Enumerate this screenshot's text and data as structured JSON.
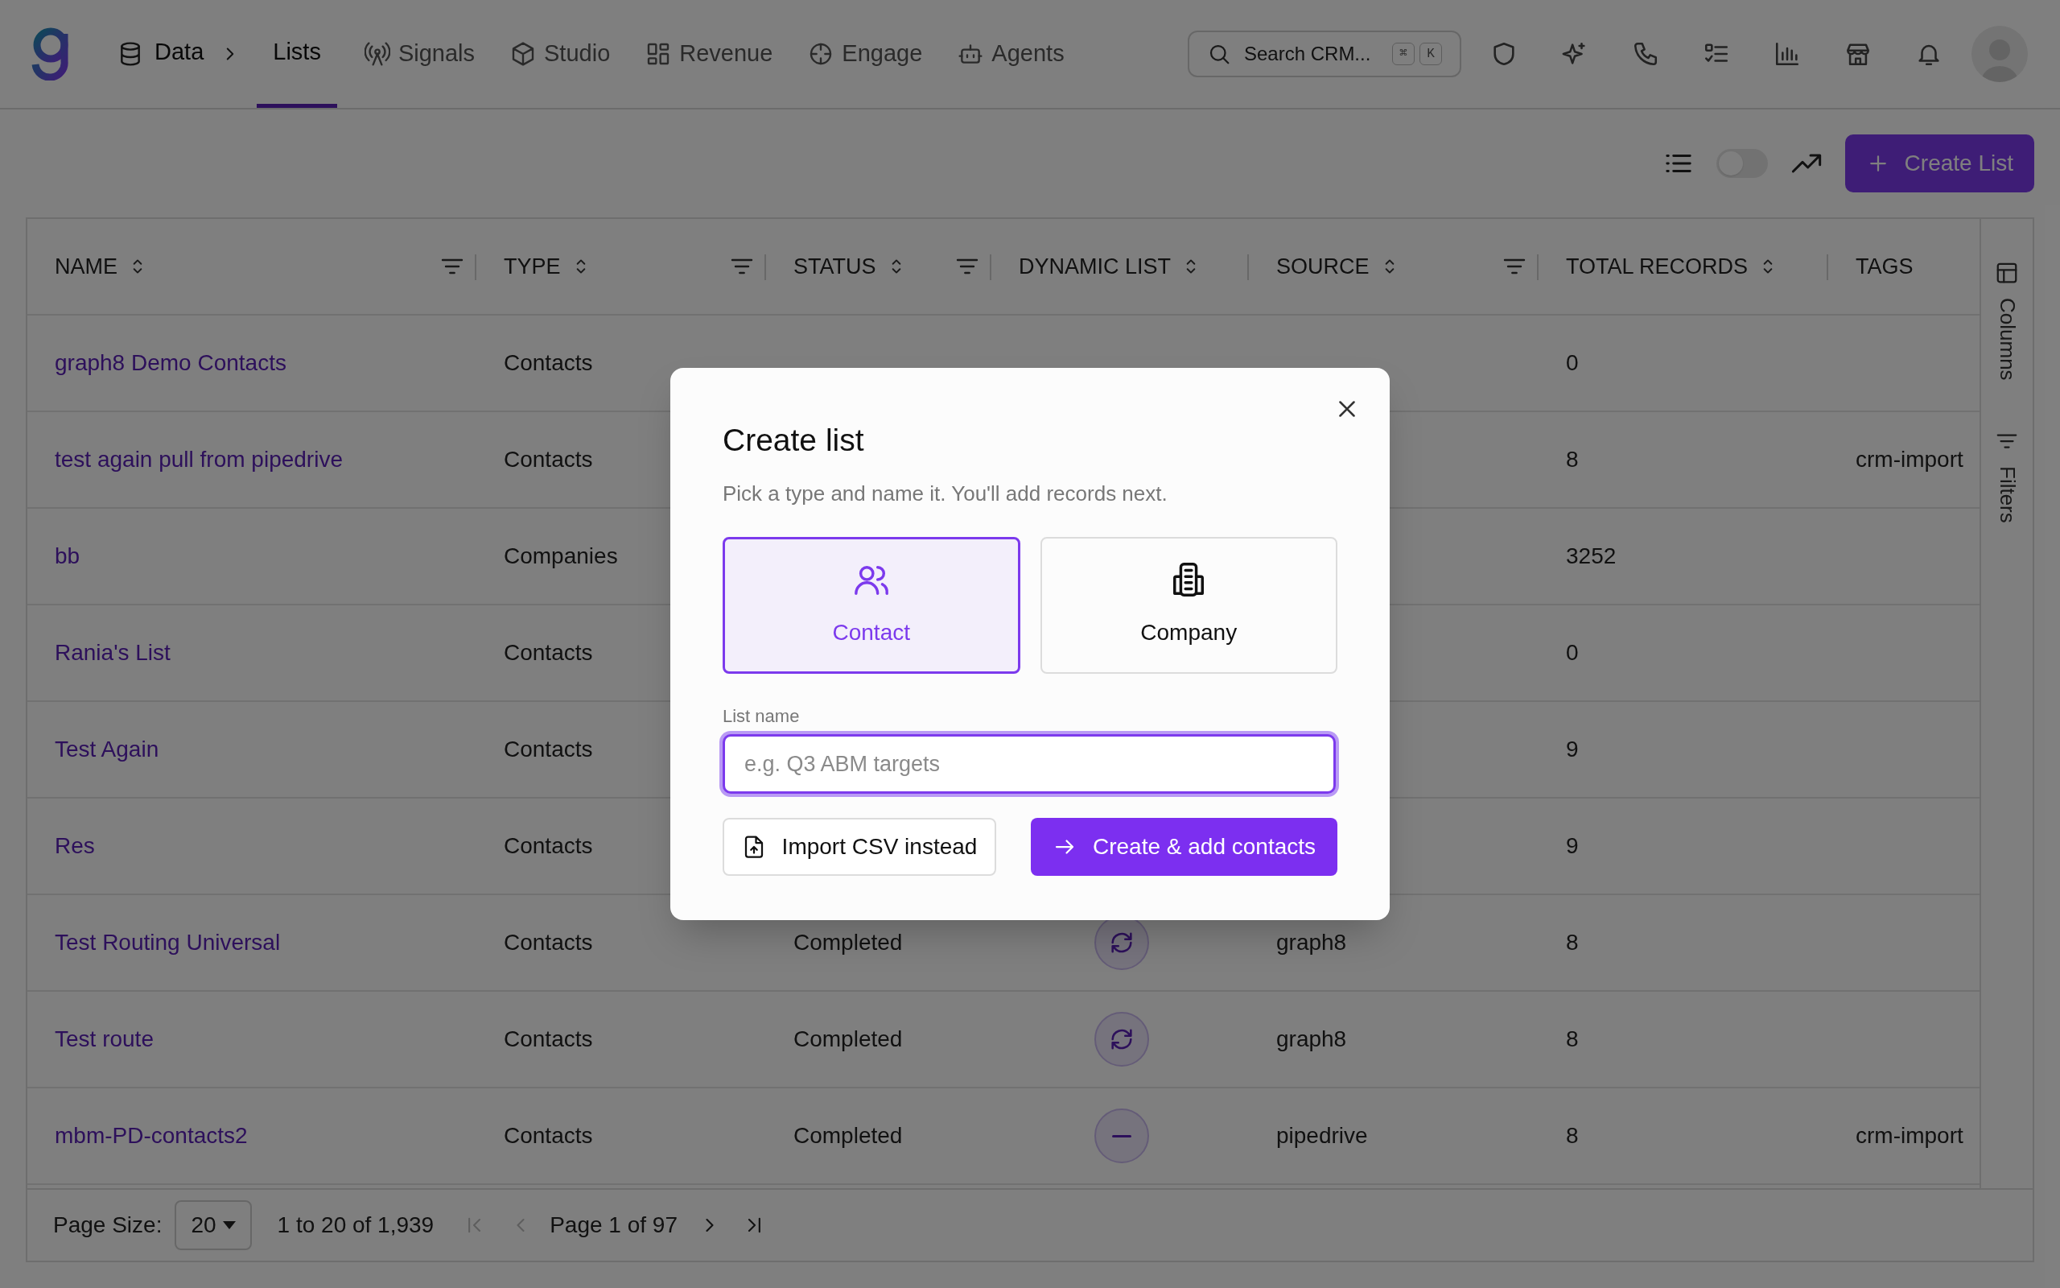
{
  "nav": {
    "breadcrumb": [
      {
        "label": "Data",
        "selected": false
      },
      {
        "label": "Lists",
        "selected": true
      }
    ],
    "items": [
      {
        "label": "Signals",
        "kind": "antenna"
      },
      {
        "label": "Studio",
        "kind": "package"
      },
      {
        "label": "Revenue",
        "kind": "grid"
      },
      {
        "label": "Engage",
        "kind": "target"
      },
      {
        "label": "Agents",
        "kind": "robot"
      }
    ],
    "search": {
      "placeholder": "Search CRM...",
      "keys": [
        "⌘",
        "K"
      ]
    },
    "actions": [
      {
        "kind": "shield"
      },
      {
        "kind": "sparkle"
      },
      {
        "kind": "phone"
      },
      {
        "kind": "checklist"
      },
      {
        "kind": "chart"
      },
      {
        "kind": "store"
      },
      {
        "kind": "bell"
      }
    ]
  },
  "toolbar": {
    "chart_view": {
      "on": false
    },
    "create_button": "Create List"
  },
  "table": {
    "columns": [
      {
        "label": "NAME",
        "sortable": true,
        "filterable": true
      },
      {
        "label": "TYPE",
        "sortable": true,
        "filterable": true
      },
      {
        "label": "STATUS",
        "sortable": true,
        "filterable": true
      },
      {
        "label": "DYNAMIC LIST",
        "sortable": true,
        "filterable": false
      },
      {
        "label": "SOURCE",
        "sortable": true,
        "filterable": true
      },
      {
        "label": "TOTAL RECORDS",
        "sortable": true,
        "filterable": false
      },
      {
        "label": "TAGS",
        "sortable": false,
        "filterable": false
      }
    ],
    "rows": [
      {
        "name": "graph8 Demo Contacts",
        "type": "Contacts",
        "total_records": "0"
      },
      {
        "name": "test again pull from pipedrive",
        "type": "Contacts",
        "total_records": "8",
        "tags": "crm-import"
      },
      {
        "name": "bb",
        "type": "Companies",
        "total_records": "3252"
      },
      {
        "name": "Rania's List",
        "type": "Contacts",
        "total_records": "0"
      },
      {
        "name": "Test Again",
        "type": "Contacts",
        "total_records": "9"
      },
      {
        "name": "Res",
        "type": "Contacts",
        "total_records": "9"
      },
      {
        "name": "Test Routing Universal",
        "type": "Contacts",
        "status": "Completed",
        "dynamic_list": {
          "kind": "sync"
        },
        "source": "graph8",
        "total_records": "8"
      },
      {
        "name": "Test route",
        "type": "Contacts",
        "status": "Completed",
        "dynamic_list": {
          "kind": "sync"
        },
        "source": "graph8",
        "total_records": "8"
      },
      {
        "name": "mbm-PD-contacts2",
        "type": "Contacts",
        "status": "Completed",
        "dynamic_list": {
          "kind": "static"
        },
        "source": "pipedrive",
        "total_records": "8",
        "tags": "crm-import"
      }
    ],
    "side_panel": [
      "Columns",
      "Filters"
    ]
  },
  "pagination": {
    "page_size_label": "Page Size:",
    "page_size": "20",
    "range": "1 to 20 of 1,939",
    "page": "Page 1 of 97",
    "buttons": [
      {
        "kind": "first",
        "disabled": true
      },
      {
        "kind": "prev",
        "disabled": true
      },
      {
        "kind": "next",
        "disabled": false
      },
      {
        "kind": "last",
        "disabled": false
      }
    ]
  },
  "modal": {
    "title": "Create list",
    "subtitle": "Pick a type and name it. You'll add records next.",
    "options": [
      {
        "label": "Contact",
        "kind": "contact",
        "selected": true
      },
      {
        "label": "Company",
        "kind": "company",
        "selected": false
      }
    ],
    "field": {
      "label": "List name",
      "placeholder": "e.g. Q3 ABM targets"
    },
    "secondary_button": "Import CSV instead",
    "primary_button": "Create & add contacts"
  }
}
